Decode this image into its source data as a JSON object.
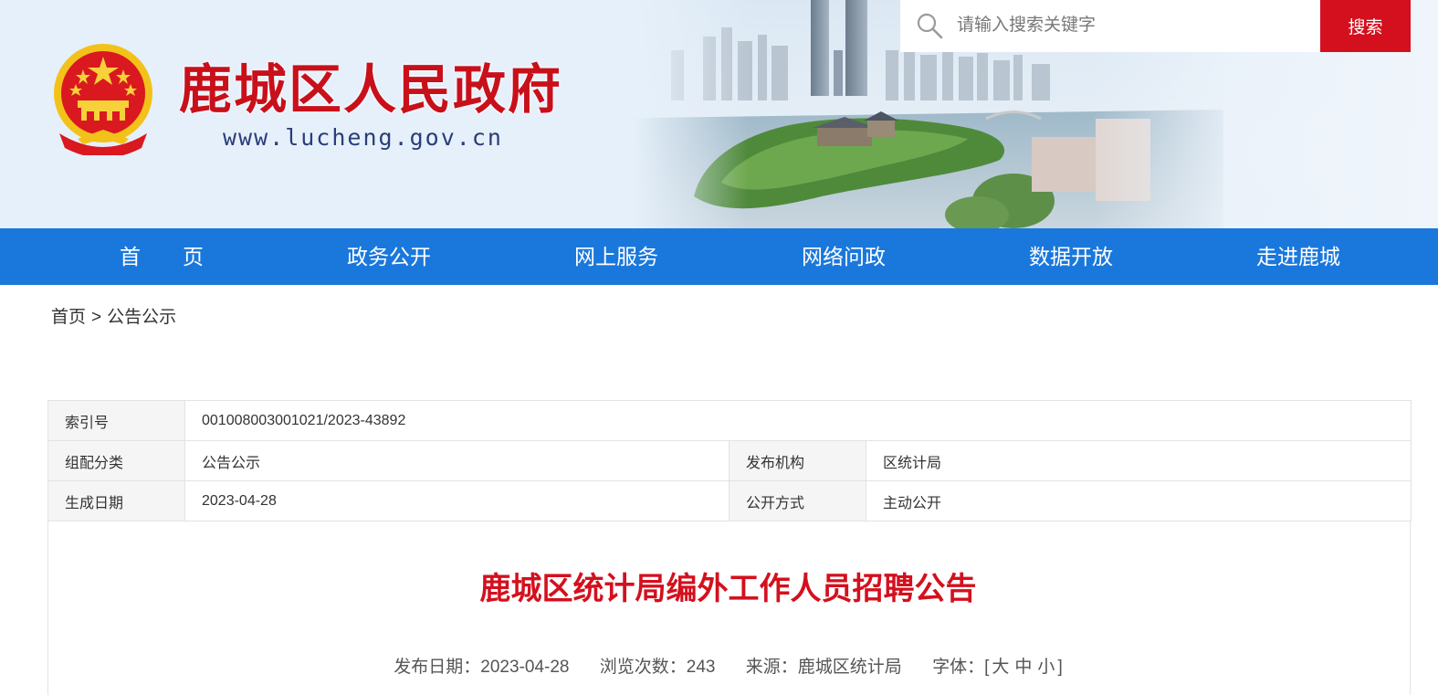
{
  "header": {
    "site_title": "鹿城区人民政府",
    "site_url": "www.lucheng.gov.cn",
    "search": {
      "placeholder": "请输入搜索关键字",
      "button_label": "搜索"
    }
  },
  "nav": {
    "items": [
      "首　　页",
      "政务公开",
      "网上服务",
      "网络问政",
      "数据开放",
      "走进鹿城"
    ]
  },
  "breadcrumb": {
    "home": "首页",
    "separator": ">",
    "current": "公告公示"
  },
  "info": {
    "index_label": "索引号",
    "index_value": "001008003001021/2023-43892",
    "category_label": "组配分类",
    "category_value": "公告公示",
    "publisher_label": "发布机构",
    "publisher_value": "区统计局",
    "created_label": "生成日期",
    "created_value": "2023-04-28",
    "open_label": "公开方式",
    "open_value": "主动公开"
  },
  "article": {
    "title": "鹿城区统计局编外工作人员招聘公告",
    "meta": {
      "date_label": "发布日期：",
      "date_value": "2023-04-28",
      "views_label": "浏览次数：",
      "views_value": "243",
      "source_label": "来源：",
      "source_value": "鹿城区统计局",
      "font_label": "字体：",
      "bracket_open": "[",
      "font_large": "大",
      "font_medium": "中",
      "font_small": "小",
      "bracket_close": "]"
    }
  },
  "colors": {
    "brand_red": "#d4101e",
    "nav_blue": "#1a78dc",
    "title_red": "#c8101b"
  }
}
